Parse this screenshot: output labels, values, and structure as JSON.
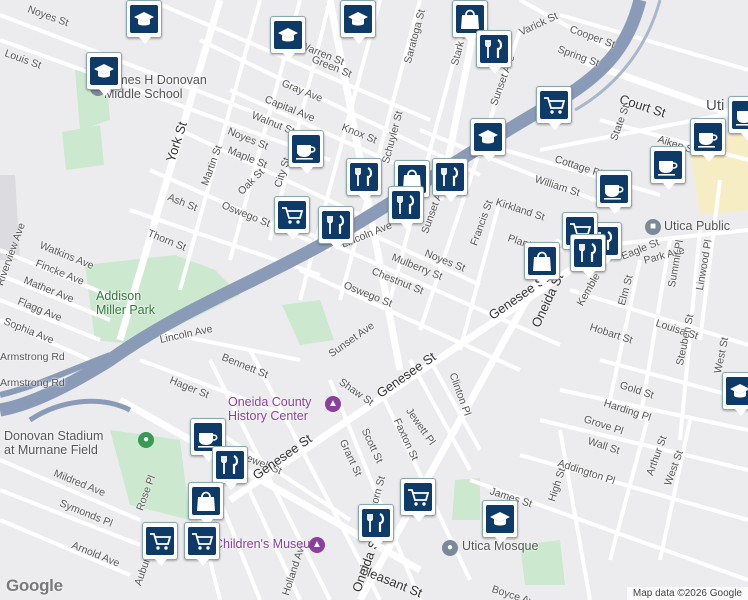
{
  "map": {
    "attribution": "Map data ©2026 Google",
    "logo": "Google",
    "city_label_partial": "Uti",
    "colors": {
      "highway": "#8a9bb8",
      "park": "#cce8cf",
      "road": "#ffffff",
      "background": "#ececef",
      "pin_icon": "#0d3a66",
      "museum": "#8c3f9e",
      "park_label": "#2e7a3a"
    }
  },
  "streets": [
    {
      "name": "Noyes St"
    },
    {
      "name": "Louis St"
    },
    {
      "name": "Warren St"
    },
    {
      "name": "Green St"
    },
    {
      "name": "Gray Ave"
    },
    {
      "name": "Capital Ave"
    },
    {
      "name": "Walnut St"
    },
    {
      "name": "Noyes St"
    },
    {
      "name": "Maple St"
    },
    {
      "name": "Martin St"
    },
    {
      "name": "Oak St"
    },
    {
      "name": "Oswego St"
    },
    {
      "name": "Ash St"
    },
    {
      "name": "Thorn St"
    },
    {
      "name": "York St"
    },
    {
      "name": "City St"
    },
    {
      "name": "Knox St"
    },
    {
      "name": "Schuyler St"
    },
    {
      "name": "Saratoga St"
    },
    {
      "name": "Stark St"
    },
    {
      "name": "Varick St"
    },
    {
      "name": "Cooper St"
    },
    {
      "name": "Spring St"
    },
    {
      "name": "Sunset Ave"
    },
    {
      "name": "Court St"
    },
    {
      "name": "State St"
    },
    {
      "name": "Aiken St"
    },
    {
      "name": "Cottage Pl"
    },
    {
      "name": "William St"
    },
    {
      "name": "Kirkland St"
    },
    {
      "name": "Plant St"
    },
    {
      "name": "Francis St"
    },
    {
      "name": "Lincoln Ave"
    },
    {
      "name": "Sunset Ave"
    },
    {
      "name": "Noyes St"
    },
    {
      "name": "Mulberry St"
    },
    {
      "name": "Chestnut St"
    },
    {
      "name": "Oswego St"
    },
    {
      "name": "Watkins Ave"
    },
    {
      "name": "Fincke Ave"
    },
    {
      "name": "Mather Ave"
    },
    {
      "name": "Flagg Ave"
    },
    {
      "name": "Sophia Ave"
    },
    {
      "name": "Riverview Ave"
    },
    {
      "name": "Lincoln Ave"
    },
    {
      "name": "Sunset Ave"
    },
    {
      "name": "Bennett St"
    },
    {
      "name": "Hager St"
    },
    {
      "name": "Shaw St"
    },
    {
      "name": "Genesee St"
    },
    {
      "name": "Genesee St"
    },
    {
      "name": "Oneida St"
    },
    {
      "name": "Kemble St"
    },
    {
      "name": "Park Ave"
    },
    {
      "name": "Elm St"
    },
    {
      "name": "Summit Pl"
    },
    {
      "name": "Linwood Pl"
    },
    {
      "name": "Hobart St"
    },
    {
      "name": "Louisa St"
    },
    {
      "name": "Steuben St"
    },
    {
      "name": "West St"
    },
    {
      "name": "Clinton Pl"
    },
    {
      "name": "Jewett Pl"
    },
    {
      "name": "Faxton St"
    },
    {
      "name": "Scott St"
    },
    {
      "name": "Grant St"
    },
    {
      "name": "Newell St"
    },
    {
      "name": "Genesee St"
    },
    {
      "name": "Gold St"
    },
    {
      "name": "Harding Pl"
    },
    {
      "name": "Grove Pl"
    },
    {
      "name": "Wall St"
    },
    {
      "name": "Arthur St"
    },
    {
      "name": "West St"
    },
    {
      "name": "Addington Pl"
    },
    {
      "name": "High St"
    },
    {
      "name": "James St"
    },
    {
      "name": "Mildred Ave"
    },
    {
      "name": "Symonds Pl"
    },
    {
      "name": "Arnold Ave"
    },
    {
      "name": "Rose Pl"
    },
    {
      "name": "Pleasant St"
    },
    {
      "name": "Oneida St"
    },
    {
      "name": "Boyce Ave"
    },
    {
      "name": "Auburn Ave"
    },
    {
      "name": "Thorn St"
    },
    {
      "name": "Holland Ave"
    },
    {
      "name": "Eagle St"
    },
    {
      "name": "Utica Public Library"
    },
    {
      "name": "Armstrong Rd"
    },
    {
      "name": "Armstrong Rd"
    }
  ],
  "places": [
    {
      "name": "James H Donovan\nMiddle School"
    },
    {
      "name": "Addison\nMiller Park"
    },
    {
      "name": "Oneida County\nHistory Center"
    },
    {
      "name": "Donovan Stadium\nat Murnane Field"
    },
    {
      "name": "Children's Museum"
    },
    {
      "name": "Utica Mosque"
    },
    {
      "name": "Utica Public"
    }
  ],
  "pins": [
    {
      "icon": "school-icon"
    },
    {
      "icon": "school-icon"
    },
    {
      "icon": "shopping-bag-icon"
    },
    {
      "icon": "school-icon"
    },
    {
      "icon": "restaurant-icon"
    },
    {
      "icon": "school-icon"
    },
    {
      "icon": "grocery-cart-icon"
    },
    {
      "icon": "cafe-icon"
    },
    {
      "icon": "school-icon"
    },
    {
      "icon": "restaurant-icon"
    },
    {
      "icon": "shopping-bag-icon"
    },
    {
      "icon": "restaurant-icon"
    },
    {
      "icon": "restaurant-icon"
    },
    {
      "icon": "grocery-cart-icon"
    },
    {
      "icon": "restaurant-icon"
    },
    {
      "icon": "cafe-icon"
    },
    {
      "icon": "cafe-icon"
    },
    {
      "icon": "cafe-icon"
    },
    {
      "icon": "cafe-icon"
    },
    {
      "icon": "shopping-bag-icon"
    },
    {
      "icon": "restaurant-icon"
    },
    {
      "icon": "grocery-cart-icon"
    },
    {
      "icon": "restaurant-icon"
    },
    {
      "icon": "cafe-icon"
    },
    {
      "icon": "restaurant-icon"
    },
    {
      "icon": "shopping-bag-icon"
    },
    {
      "icon": "grocery-cart-icon"
    },
    {
      "icon": "restaurant-icon"
    },
    {
      "icon": "school-icon"
    },
    {
      "icon": "grocery-cart-icon"
    },
    {
      "icon": "grocery-cart-icon"
    },
    {
      "icon": "school-icon"
    }
  ]
}
